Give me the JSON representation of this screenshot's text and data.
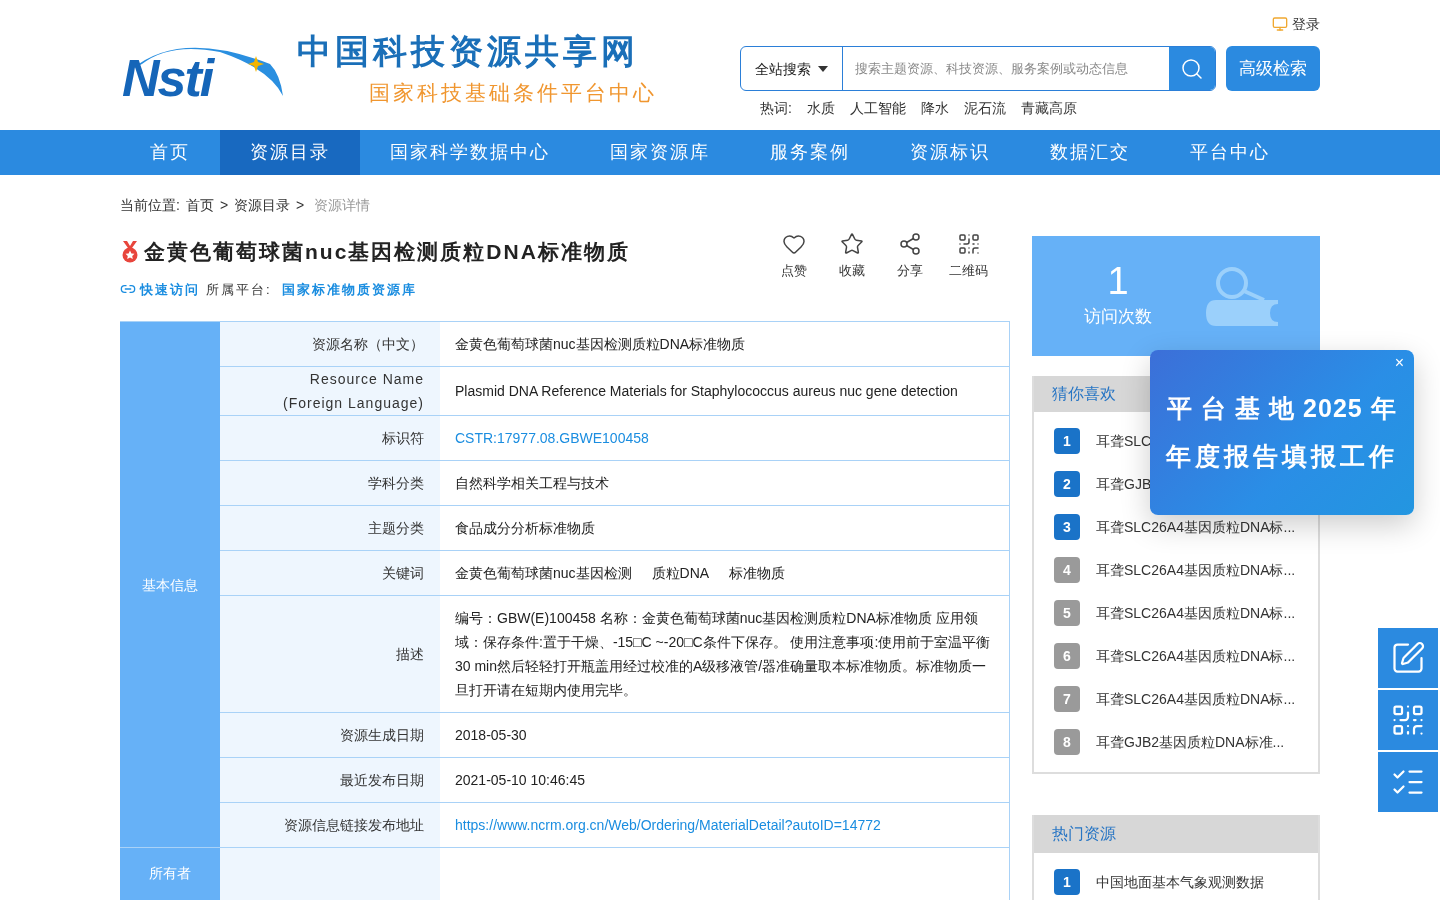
{
  "header": {
    "logo_text": "Nsti",
    "site_title": "中国科技资源共享网",
    "site_subtitle": "国家科技基础条件平台中心",
    "login": "登录",
    "search": {
      "scope": "全站搜索",
      "placeholder": "搜索主题资源、科技资源、服务案例或动态信息"
    },
    "advanced_search": "高级检索",
    "hot_label": "热词:",
    "hot_words": [
      "水质",
      "人工智能",
      "降水",
      "泥石流",
      "青藏高原"
    ]
  },
  "nav": [
    {
      "label": "首页",
      "selected": false
    },
    {
      "label": "资源目录",
      "selected": true
    },
    {
      "label": "国家科学数据中心",
      "selected": false
    },
    {
      "label": "国家资源库",
      "selected": false
    },
    {
      "label": "服务案例",
      "selected": false
    },
    {
      "label": "资源标识",
      "selected": false
    },
    {
      "label": "数据汇交",
      "selected": false
    },
    {
      "label": "平台中心",
      "selected": false
    }
  ],
  "breadcrumb": {
    "label": "当前位置:",
    "items": [
      {
        "text": "首页",
        "current": false
      },
      {
        "text": "资源目录",
        "current": false
      },
      {
        "text": "资源详情",
        "current": true
      }
    ],
    "separator": ">"
  },
  "resource": {
    "title": "金黄色葡萄球菌nuc基因检测质粒DNA标准物质",
    "quick_access": "快速访问",
    "platform_label": "所属平台:",
    "platform": "国家标准物质资源库",
    "actions": [
      {
        "kind": "like",
        "label": "点赞"
      },
      {
        "kind": "favorite",
        "label": "收藏"
      },
      {
        "kind": "share",
        "label": "分享"
      },
      {
        "kind": "qrcode",
        "label": "二维码"
      }
    ]
  },
  "table": {
    "groups": [
      {
        "label": "基本信息",
        "rows": [
          {
            "label": "资源名称（中文）",
            "kind": "text",
            "value": "金黄色葡萄球菌nuc基因检测质粒DNA标准物质"
          },
          {
            "label": "Resource Name (Foreign Language)",
            "kind": "text",
            "value": "Plasmid DNA Reference Materials for Staphylococcus aureus nuc gene detection"
          },
          {
            "label": "标识符",
            "kind": "link",
            "value": "CSTR:17977.08.GBWE100458"
          },
          {
            "label": "学科分类",
            "kind": "text",
            "value": "自然科学相关工程与技术"
          },
          {
            "label": "主题分类",
            "kind": "text",
            "value": "食品成分分析标准物质"
          },
          {
            "label": "关键词",
            "kind": "tags",
            "values": [
              "金黄色葡萄球菌nuc基因检测",
              "质粒DNA",
              "标准物质"
            ]
          },
          {
            "label": "描述",
            "kind": "text",
            "value": "编号：GBW(E)100458 名称：金黄色葡萄球菌nuc基因检测质粒DNA标准物质 应用领域：保存条件:置于干燥、-15□C ~-20□C条件下保存。 使用注意事项:使用前于室温平衡30 min然后轻轻打开瓶盖用经过校准的A级移液管/器准确量取本标准物质。标准物质一旦打开请在短期内使用完毕。"
          },
          {
            "label": "资源生成日期",
            "kind": "text",
            "value": "2018-05-30"
          },
          {
            "label": "最近发布日期",
            "kind": "text",
            "value": "2021-05-10 10:46:45"
          },
          {
            "label": "资源信息链接发布地址",
            "kind": "link",
            "value": "https://www.ncrm.org.cn/Web/Ordering/MaterialDetail?autoID=14772"
          }
        ]
      },
      {
        "label": "所有者"
      }
    ]
  },
  "visits": {
    "count": "1",
    "label": "访问次数"
  },
  "guess": {
    "title": "猜你喜欢",
    "items": [
      {
        "rank": "1",
        "text": "耳聋SLC",
        "top": true
      },
      {
        "rank": "2",
        "text": "耳聋GJB",
        "top": true
      },
      {
        "rank": "3",
        "text": "耳聋SLC26A4基因质粒DNA标...",
        "top": true
      },
      {
        "rank": "4",
        "text": "耳聋SLC26A4基因质粒DNA标...",
        "top": false
      },
      {
        "rank": "5",
        "text": "耳聋SLC26A4基因质粒DNA标...",
        "top": false
      },
      {
        "rank": "6",
        "text": "耳聋SLC26A4基因质粒DNA标...",
        "top": false
      },
      {
        "rank": "7",
        "text": "耳聋SLC26A4基因质粒DNA标...",
        "top": false
      },
      {
        "rank": "8",
        "text": "耳聋GJB2基因质粒DNA标准...",
        "top": false
      }
    ]
  },
  "hot": {
    "title": "热门资源",
    "items": [
      {
        "rank": "1",
        "text": "中国地面基本气象观测数据",
        "top": true
      }
    ]
  },
  "popup": {
    "close": "×",
    "line1": "平 台 基 地 2025 年",
    "line2": "年度报告填报工作"
  },
  "side_tools": [
    {
      "kind": "edit"
    },
    {
      "kind": "qrcode"
    },
    {
      "kind": "checklist"
    }
  ]
}
